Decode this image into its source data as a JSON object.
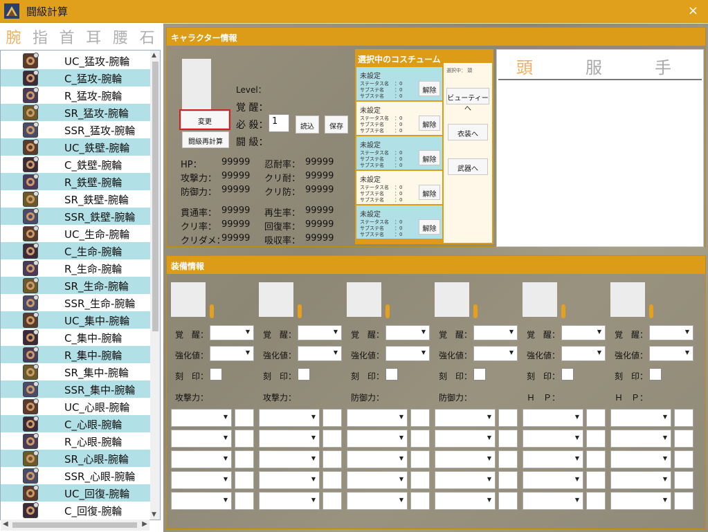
{
  "window": {
    "title": "闘級計算",
    "close": "×"
  },
  "categories": [
    "腕",
    "指",
    "首",
    "耳",
    "腰",
    "石"
  ],
  "equipment_list": [
    "UC_猛攻-腕輪",
    "C_猛攻-腕輪",
    "R_猛攻-腕輪",
    "SR_猛攻-腕輪",
    "SSR_猛攻-腕輪",
    "UC_鉄壁-腕輪",
    "C_鉄壁-腕輪",
    "R_鉄壁-腕輪",
    "SR_鉄壁-腕輪",
    "SSR_鉄壁-腕輪",
    "UC_生命-腕輪",
    "C_生命-腕輪",
    "R_生命-腕輪",
    "SR_生命-腕輪",
    "SSR_生命-腕輪",
    "UC_集中-腕輪",
    "C_集中-腕輪",
    "R_集中-腕輪",
    "SR_集中-腕輪",
    "SSR_集中-腕輪",
    "UC_心眼-腕輪",
    "C_心眼-腕輪",
    "R_心眼-腕輪",
    "SR_心眼-腕輪",
    "SSR_心眼-腕輪",
    "UC_回復-腕輪",
    "C_回復-腕輪"
  ],
  "character": {
    "header": "キャラクター情報",
    "change_button": "変更",
    "recalc_button": "闘級再計算",
    "level_label": "Level：",
    "awaken_label": "覚 醒：",
    "special_label": "必 殺：",
    "special_value": "1",
    "load_button": "読込",
    "save_button": "保存",
    "rank_label": "闘 級：",
    "stats": [
      {
        "label": "HP：",
        "value": "99999"
      },
      {
        "label": "忍耐率：",
        "value": "99999"
      },
      {
        "label": "攻撃力：",
        "value": "99999"
      },
      {
        "label": "クリ耐：",
        "value": "99999"
      },
      {
        "label": "防御力：",
        "value": "99999"
      },
      {
        "label": "クリ防：",
        "value": "99999"
      },
      {
        "label": "貫通率：",
        "value": "99999"
      },
      {
        "label": "再生率：",
        "value": "99999"
      },
      {
        "label": "クリ率：",
        "value": "99999"
      },
      {
        "label": "回復率：",
        "value": "99999"
      },
      {
        "label": "クリダメ：",
        "value": "99999"
      },
      {
        "label": "吸収率：",
        "value": "99999"
      }
    ]
  },
  "costume": {
    "header": "選択中のコスチューム",
    "selected_info": "選択中： 頭",
    "slot_name": "未設定",
    "slot_stat": "ステータス名",
    "slot_sub": "サブステ名",
    "slot_val": "：0",
    "release_button": "解除",
    "beauty_button": "ビューティーへ",
    "clothes_button": "衣装へ",
    "weapon_button": "武器へ"
  },
  "parts_tabs": [
    "頭",
    "服",
    "手"
  ],
  "equip": {
    "header": "装備情報",
    "awaken_label": "覚　醒：",
    "enhance_label": "強化値：",
    "seal_label": "刻　印：",
    "main_stats": [
      "攻撃力：",
      "攻撃力：",
      "防御力：",
      "防御力：",
      "Ｈ　Ｐ：",
      "Ｈ　Ｐ："
    ]
  }
}
